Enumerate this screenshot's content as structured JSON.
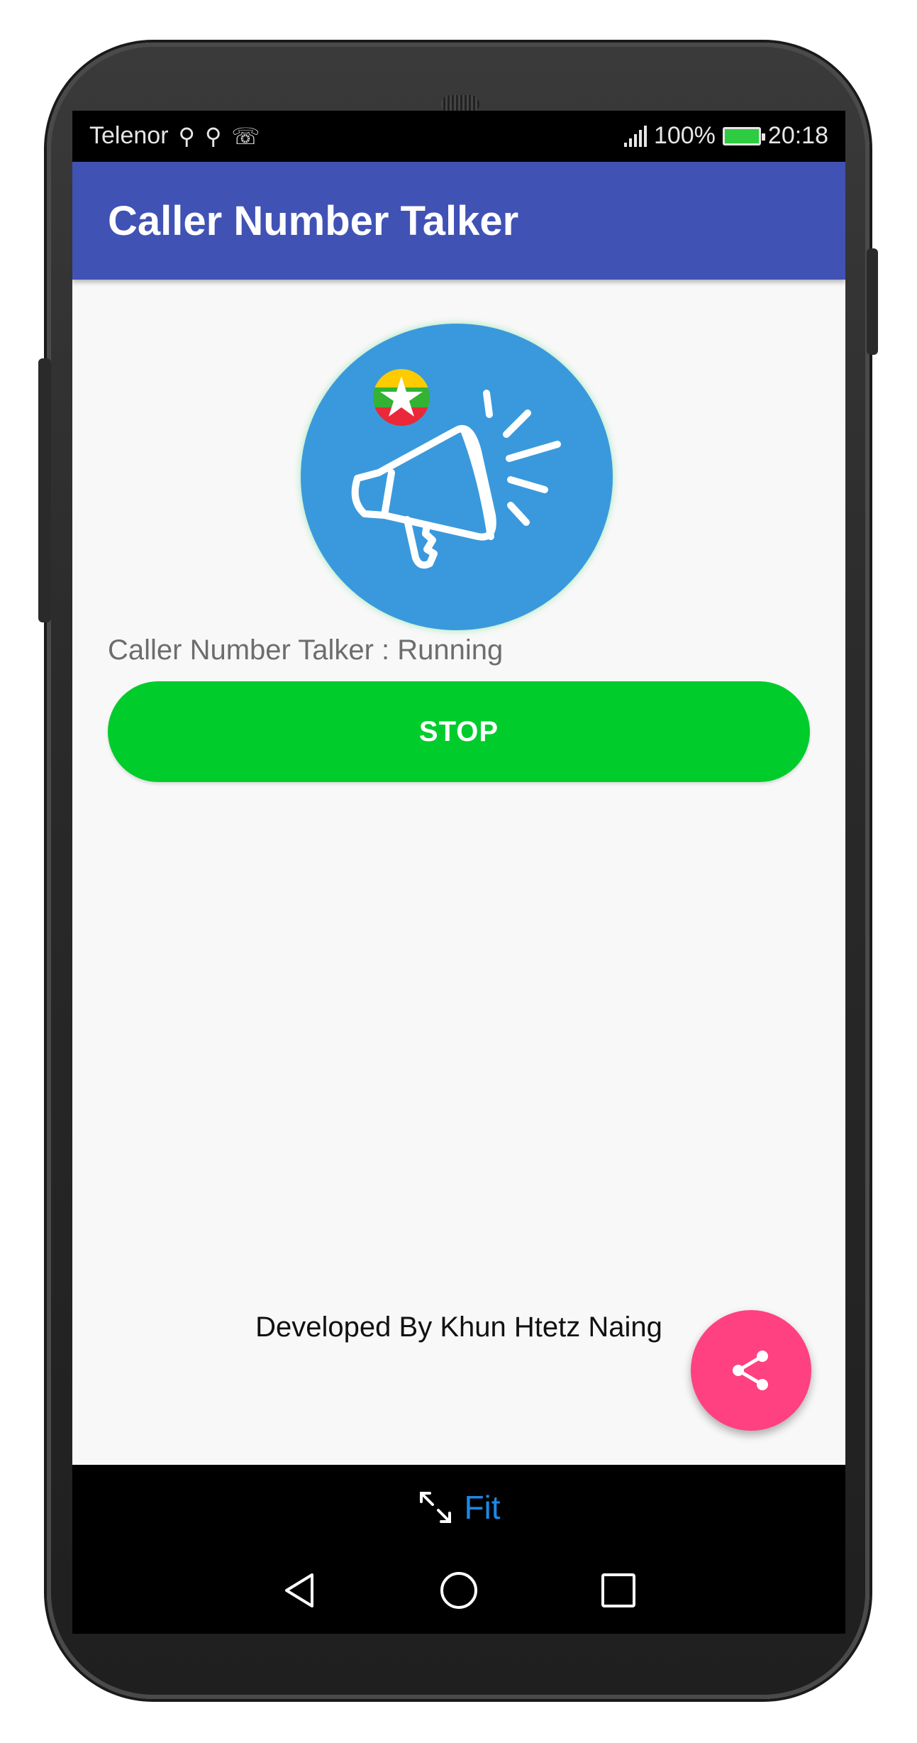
{
  "status_bar": {
    "carrier": "Telenor",
    "battery_percent": "100%",
    "time": "20:18",
    "icons": [
      "usb-icon",
      "usb-icon",
      "missed-call-icon",
      "signal-icon",
      "battery-charging-icon"
    ]
  },
  "app_bar": {
    "title": "Caller Number Talker"
  },
  "main": {
    "status_text": "Caller Number Talker : Running",
    "stop_button_label": "STOP",
    "developer_text": "Developed By Khun Htetz Naing"
  },
  "fab": {
    "icon": "share-icon"
  },
  "bottom": {
    "fit_label": "Fit",
    "nav_icons": [
      "back-icon",
      "home-icon",
      "recents-icon"
    ]
  },
  "colors": {
    "app_bar": "#4152b5",
    "stop_button": "#00cc2c",
    "fab": "#ff4081",
    "logo_background": "#3a99dc",
    "fit_text": "#1e88e5"
  }
}
